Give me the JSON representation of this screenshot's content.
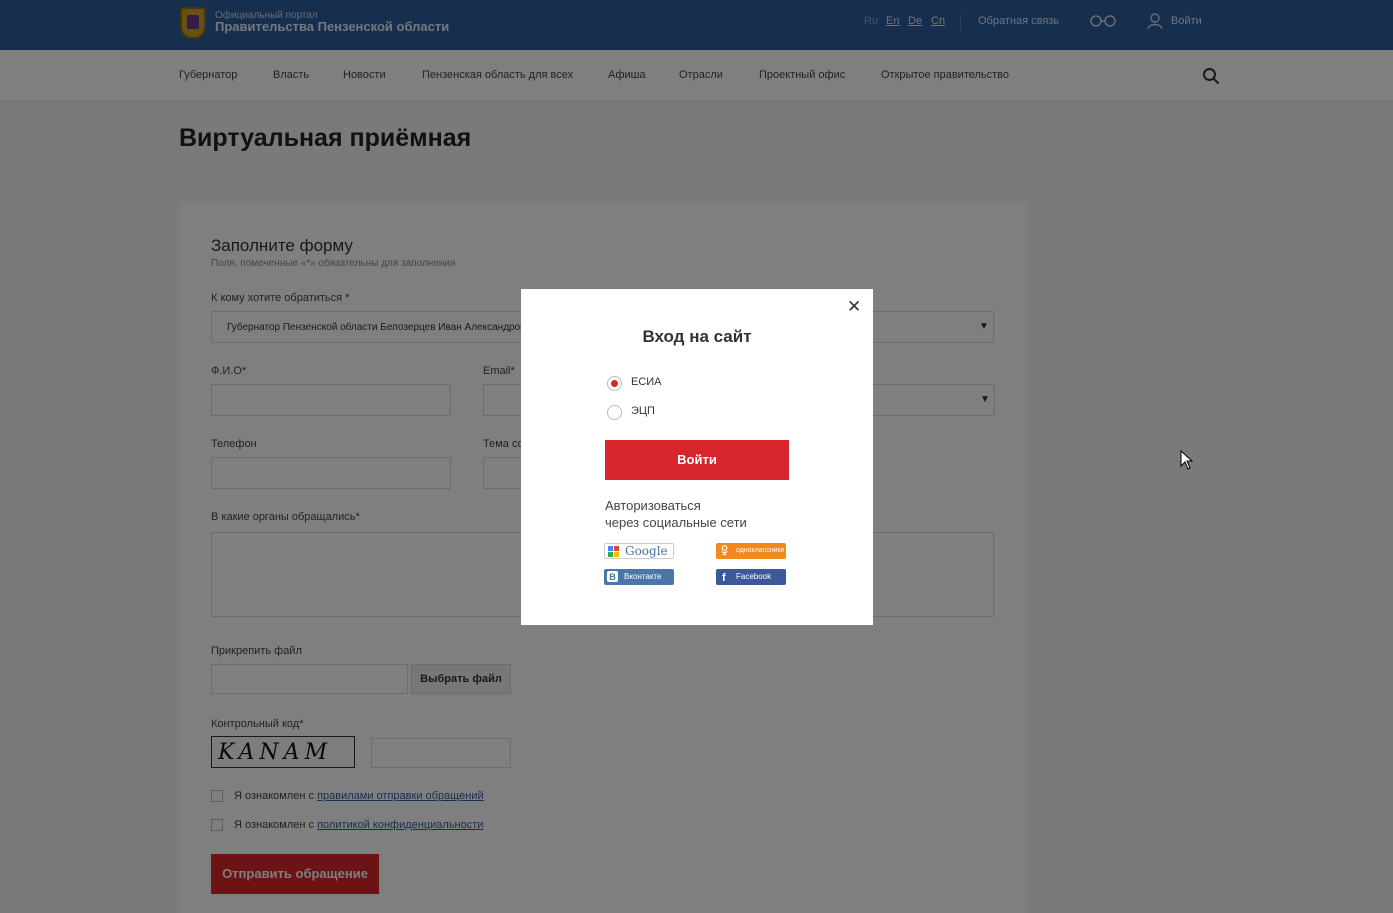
{
  "header": {
    "portal_small": "Официальный портал",
    "portal_big": "Правительства Пензенской области",
    "langs": [
      "Ru",
      "En",
      "De",
      "Cn"
    ],
    "feedback": "Обратная связь",
    "login": "Войти"
  },
  "nav": {
    "items": [
      "Губернатор",
      "Власть",
      "Новости",
      "Пензенская область для всех",
      "Афиша",
      "Отрасли",
      "Проектный офис",
      "Открытое правительство"
    ]
  },
  "page": {
    "title": "Виртуальная приёмная"
  },
  "form": {
    "title": "Заполните форму",
    "hint": "Поля, помеченные «*» обязательны для заполнения",
    "addressee_label": "К кому хотите обратиться *",
    "addressee_value": "Губернатор Пензенской области Белозерцев Иван Александрович",
    "fio_label": "Ф.И.О*",
    "email_label": "Email*",
    "phone_label": "Телефон",
    "topic_label": "Тема со",
    "organs_label": "В какие органы обращались*",
    "attach_label": "Прикрепить файл",
    "choose_file": "Выбрать файл",
    "captcha_label": "Контрольный код*",
    "captcha_text": "KANAM",
    "agree_prefix": "Я ознакомлен с",
    "agree_rules_link": "правилами отправки обращений",
    "agree_privacy_link": "политикой конфиденциальности",
    "submit": "Отправить обращение"
  },
  "modal": {
    "title": "Вход на сайт",
    "options": [
      {
        "label": "ЕСИА",
        "selected": true
      },
      {
        "label": "ЭЦП",
        "selected": false
      }
    ],
    "login_button": "Войти",
    "social_caption_1": "Авторизоваться",
    "social_caption_2": "через социальные сети",
    "social": {
      "google": "Google",
      "ok": "одноклассники",
      "vk": "Вконтакте",
      "fb": "Facebook"
    }
  },
  "colors": {
    "topbar": "#2d5f9e",
    "accent_red": "#d7262b",
    "overlay": "rgba(0,0,0,0.5)"
  }
}
